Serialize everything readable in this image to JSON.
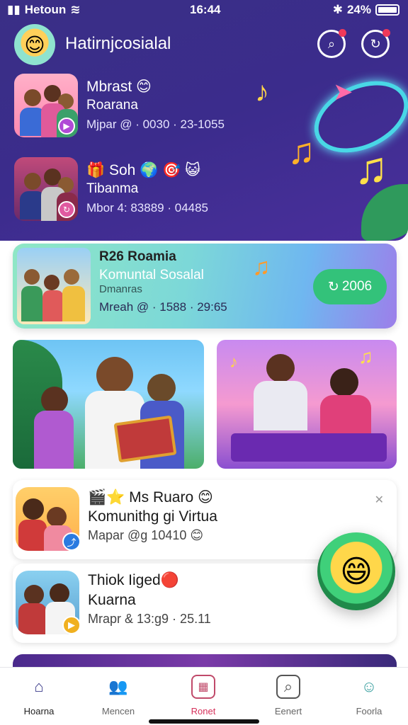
{
  "status": {
    "carrier": "Hetoun",
    "time": "16:44",
    "battery": "24%"
  },
  "header": {
    "title": "Hatirnjcosialal"
  },
  "hero_items": [
    {
      "title": "Mbrast 😊",
      "subtitle": "Roarana",
      "meta": "Mjpar @ · 0030 · 23-1055"
    },
    {
      "title": "🎁 Soh 🌍 🎯 😺",
      "subtitle": "Tibanma",
      "meta": "Mbor 4: 83889 · 04485"
    }
  ],
  "feature": {
    "title": "R26 Roamia",
    "subtitle": "Komuntal Sosalal",
    "tag": "Dmanras",
    "meta": "Mreah @ · 1588 · 29:65",
    "pill_label": "2006"
  },
  "list_items": [
    {
      "title": "🎬⭐ Ms Ruaro 😊",
      "subtitle": "Komunithg gi Virtua",
      "meta": "Mapar @g 10410 😊"
    },
    {
      "title": "Thiok Iiged🔴",
      "subtitle": "Kuarna",
      "meta": "Mrapr & 13:g9 · 25.11"
    }
  ],
  "bottom_nav": [
    {
      "label": "Hoarna",
      "icon": "home-icon"
    },
    {
      "label": "Mencen",
      "icon": "people-icon"
    },
    {
      "label": "Ronet",
      "icon": "calendar-icon"
    },
    {
      "label": "Eenert",
      "icon": "search-icon"
    },
    {
      "label": "Foorla",
      "icon": "profile-icon"
    }
  ],
  "colors": {
    "hero_bg": "#3a2f86",
    "accent_green": "#33c27a",
    "nav_active_red": "#d6305a"
  }
}
